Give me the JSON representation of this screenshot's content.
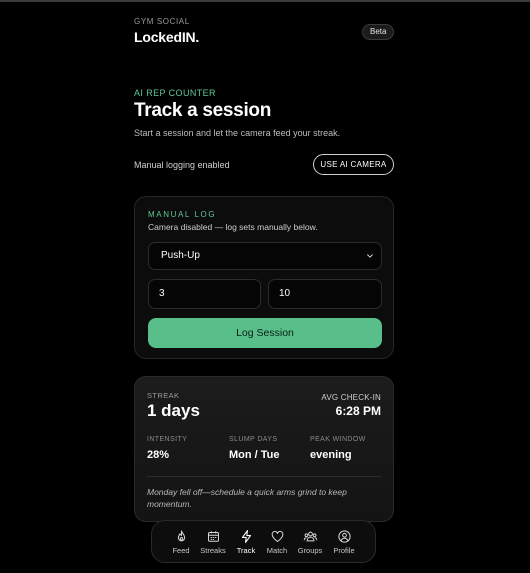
{
  "brand": {
    "kicker": "GYM SOCIAL",
    "name": "LockedIN.",
    "badge": "Beta"
  },
  "hero": {
    "kicker": "AI REP COUNTER",
    "title": "Track a session",
    "subtitle": "Start a session and let the camera feed your streak."
  },
  "mode": {
    "status": "Manual logging enabled",
    "ai_button": "USE AI CAMERA"
  },
  "manual_log": {
    "kicker": "MANUAL LOG",
    "note": "Camera disabled — log sets manually below.",
    "exercise": "Push-Up",
    "sets": "3",
    "reps": "10",
    "submit": "Log Session"
  },
  "streak": {
    "label": "STREAK",
    "value": "1 days",
    "avg_label": "AVG CHECK-IN",
    "avg_value": "6:28 PM",
    "stats": [
      {
        "label": "INTENSITY",
        "value": "28%"
      },
      {
        "label": "SLUMP DAYS",
        "value": "Mon / Tue"
      },
      {
        "label": "PEAK WINDOW",
        "value": "evening"
      }
    ],
    "note": "Monday fell off—schedule a quick arms grind to keep momentum."
  },
  "nav": {
    "active": "Track",
    "items": [
      {
        "label": "Feed",
        "icon": "flame-icon"
      },
      {
        "label": "Streaks",
        "icon": "calendar-icon"
      },
      {
        "label": "Track",
        "icon": "bolt-icon"
      },
      {
        "label": "Match",
        "icon": "heart-icon"
      },
      {
        "label": "Groups",
        "icon": "users-icon"
      },
      {
        "label": "Profile",
        "icon": "user-circle-icon"
      }
    ]
  },
  "colors": {
    "accent": "#59bf8a",
    "kicker": "#5ec796",
    "background": "#000000"
  }
}
